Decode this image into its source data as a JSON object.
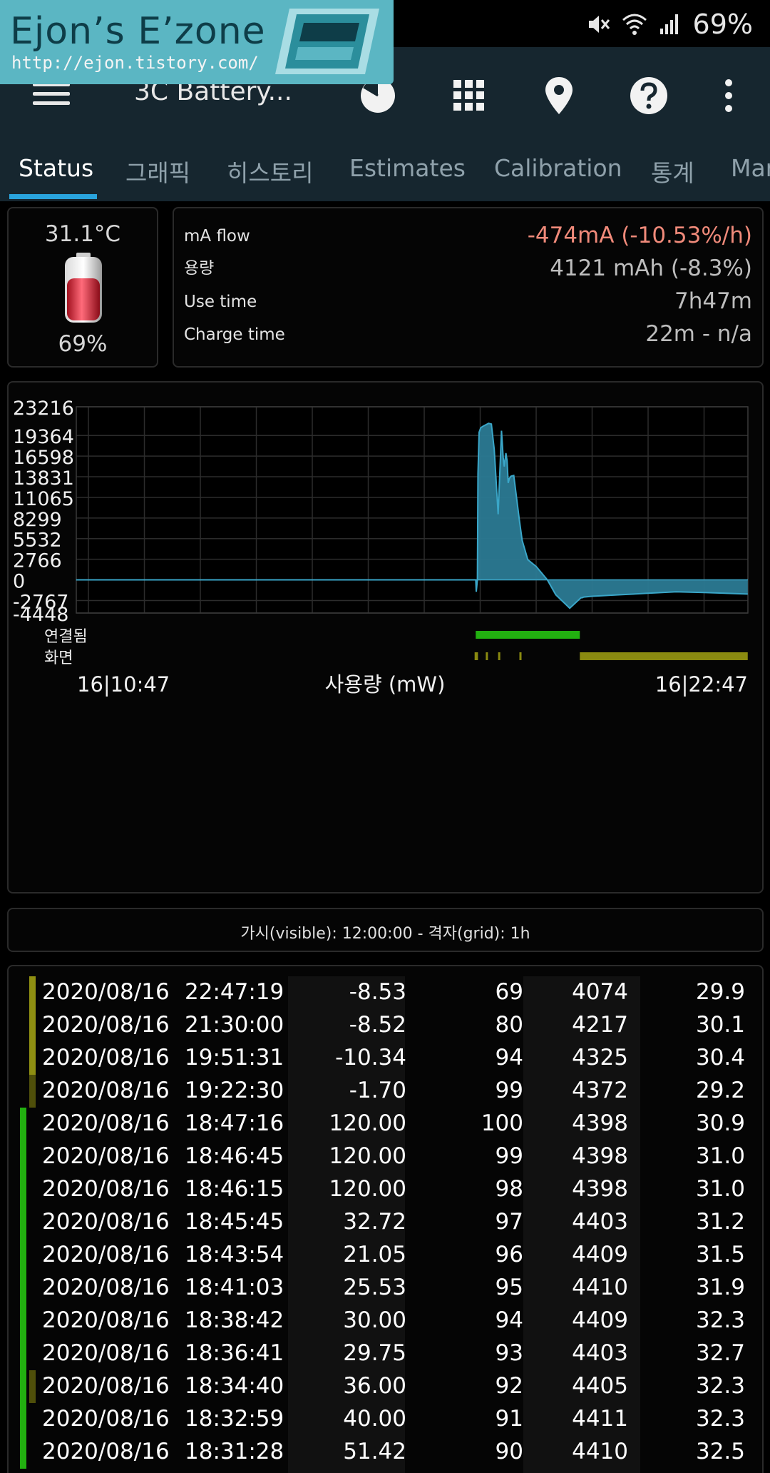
{
  "status_bar": {
    "battery_percent": "69%"
  },
  "logo": {
    "title": "Ejon’s E’zone",
    "url": "http://ejon.tistory.com/"
  },
  "app_bar": {
    "title": "3C Battery..."
  },
  "tabs": [
    "Status",
    "그래픽",
    "히스토리",
    "Estimates",
    "Calibration",
    "통계",
    "Mar"
  ],
  "battery": {
    "temperature": "31.1°C",
    "level": "69%"
  },
  "info": [
    {
      "label": "mA flow",
      "value": "-474mA (-10.53%/h)"
    },
    {
      "label": "용량",
      "value": "4121 mAh (-8.3%)"
    },
    {
      "label": "Use time",
      "value": "7h47m"
    },
    {
      "label": "Charge time",
      "value": "22m - n/a"
    }
  ],
  "colors": {
    "accent": "#29a3dc",
    "series": "#3aa6c8",
    "connected": "#22b010",
    "screen": "#8a8a10",
    "negative": "#f08a7a"
  },
  "chart_data": {
    "type": "area",
    "xlabel": "사용량 (mW)",
    "x_start": "16|10:47",
    "x_end": "16|22:47",
    "y_ticks": [
      "23216",
      "19364",
      "16598",
      "13831",
      "11065",
      "8299",
      "5532",
      "2766",
      "0",
      "-2767",
      "-4448"
    ],
    "ylim": [
      -4448,
      23216
    ],
    "xlim_hours": [
      10.783,
      22.783
    ],
    "grid": true,
    "series": [
      {
        "x": [
          10.78,
          17.92,
          17.93,
          17.95,
          17.96,
          17.98,
          18.01,
          18.05,
          18.15,
          18.2,
          18.25,
          18.32,
          18.38,
          18.41,
          18.43,
          18.46,
          18.48,
          18.5,
          18.52,
          18.55,
          18.6,
          18.7,
          18.75,
          18.85,
          19.0,
          19.2,
          19.35,
          19.6,
          19.8,
          19.82,
          19.85,
          20.0,
          20.5,
          21.0,
          21.5,
          22.0,
          22.78
        ],
        "y": [
          0,
          0,
          -1600,
          0,
          14200,
          19800,
          20400,
          20600,
          21000,
          20900,
          17500,
          8800,
          20000,
          16500,
          15200,
          17000,
          16000,
          13000,
          13600,
          13900,
          14000,
          8000,
          5300,
          2700,
          1800,
          0,
          -2000,
          -3800,
          -2400,
          -2400,
          -2300,
          -2200,
          -2000,
          -1800,
          -1600,
          -1700,
          -1900
        ]
      }
    ],
    "connected_intervals": [
      [
        17.92,
        19.78
      ]
    ],
    "screen_intervals": [
      [
        17.9,
        17.96
      ],
      [
        18.1,
        18.13
      ],
      [
        18.32,
        18.34
      ],
      [
        18.7,
        18.72
      ],
      [
        19.78,
        22.78
      ]
    ],
    "indicator_labels": [
      "연결됨",
      "화면"
    ]
  },
  "visible_info": "가시(visible): 12:00:00 - 격자(grid): 1h",
  "history": [
    {
      "date": "2020/08/16",
      "time": "22:47:19",
      "ma": "-8.53",
      "pct": "69",
      "mv": "4074",
      "temp": "29.9",
      "screen": "on",
      "charging": false
    },
    {
      "date": "2020/08/16",
      "time": "21:30:00",
      "ma": "-8.52",
      "pct": "80",
      "mv": "4217",
      "temp": "30.1",
      "screen": "on",
      "charging": false
    },
    {
      "date": "2020/08/16",
      "time": "19:51:31",
      "ma": "-10.34",
      "pct": "94",
      "mv": "4325",
      "temp": "30.4",
      "screen": "on",
      "charging": false
    },
    {
      "date": "2020/08/16",
      "time": "19:22:30",
      "ma": "-1.70",
      "pct": "99",
      "mv": "4372",
      "temp": "29.2",
      "screen": "dim",
      "charging": false
    },
    {
      "date": "2020/08/16",
      "time": "18:47:16",
      "ma": "120.00",
      "pct": "100",
      "mv": "4398",
      "temp": "30.9",
      "screen": "off",
      "charging": true
    },
    {
      "date": "2020/08/16",
      "time": "18:46:45",
      "ma": "120.00",
      "pct": "99",
      "mv": "4398",
      "temp": "31.0",
      "screen": "off",
      "charging": true
    },
    {
      "date": "2020/08/16",
      "time": "18:46:15",
      "ma": "120.00",
      "pct": "98",
      "mv": "4398",
      "temp": "31.0",
      "screen": "off",
      "charging": true
    },
    {
      "date": "2020/08/16",
      "time": "18:45:45",
      "ma": "32.72",
      "pct": "97",
      "mv": "4403",
      "temp": "31.2",
      "screen": "off",
      "charging": true
    },
    {
      "date": "2020/08/16",
      "time": "18:43:54",
      "ma": "21.05",
      "pct": "96",
      "mv": "4409",
      "temp": "31.5",
      "screen": "off",
      "charging": true
    },
    {
      "date": "2020/08/16",
      "time": "18:41:03",
      "ma": "25.53",
      "pct": "95",
      "mv": "4410",
      "temp": "31.9",
      "screen": "off",
      "charging": true
    },
    {
      "date": "2020/08/16",
      "time": "18:38:42",
      "ma": "30.00",
      "pct": "94",
      "mv": "4409",
      "temp": "32.3",
      "screen": "off",
      "charging": true
    },
    {
      "date": "2020/08/16",
      "time": "18:36:41",
      "ma": "29.75",
      "pct": "93",
      "mv": "4403",
      "temp": "32.7",
      "screen": "off",
      "charging": true
    },
    {
      "date": "2020/08/16",
      "time": "18:34:40",
      "ma": "36.00",
      "pct": "92",
      "mv": "4405",
      "temp": "32.3",
      "screen": "dim",
      "charging": true
    },
    {
      "date": "2020/08/16",
      "time": "18:32:59",
      "ma": "40.00",
      "pct": "91",
      "mv": "4411",
      "temp": "32.3",
      "screen": "off",
      "charging": true
    },
    {
      "date": "2020/08/16",
      "time": "18:31:28",
      "ma": "51.42",
      "pct": "90",
      "mv": "4410",
      "temp": "32.5",
      "screen": "off",
      "charging": true
    }
  ]
}
